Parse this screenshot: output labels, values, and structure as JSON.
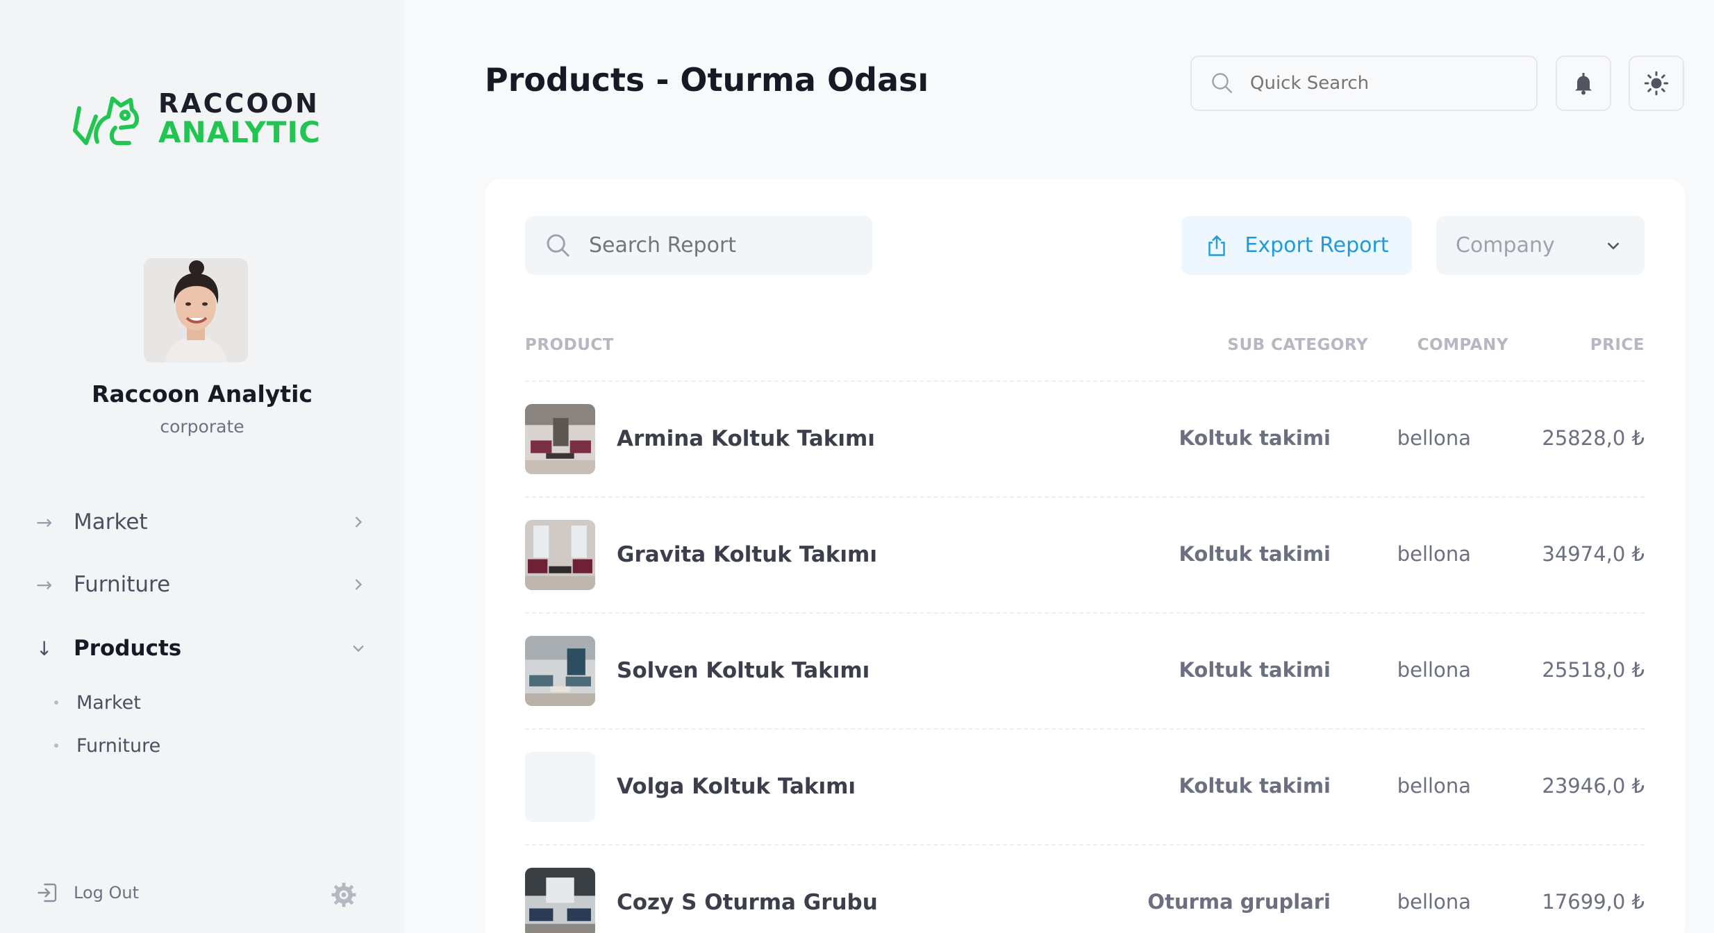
{
  "brand": {
    "line1": "RACCOON",
    "line2": "ANALYTIC",
    "accent": "#23c552"
  },
  "profile": {
    "name": "Raccoon Analytic",
    "role": "corporate"
  },
  "sidebar": {
    "items": [
      {
        "label": "Market",
        "icon": "arrow-right-icon",
        "chevron": "chevron-right-icon"
      },
      {
        "label": "Furniture",
        "icon": "arrow-right-icon",
        "chevron": "chevron-right-icon"
      },
      {
        "label": "Products",
        "icon": "arrow-down-icon",
        "chevron": "chevron-down-icon",
        "active": true
      }
    ],
    "sub_items": [
      {
        "label": "Market"
      },
      {
        "label": "Furniture"
      }
    ],
    "logout_label": "Log Out"
  },
  "header": {
    "title": "Products - Oturma Odası",
    "quick_search_placeholder": "Quick Search"
  },
  "toolbar": {
    "search_placeholder": "Search Report",
    "export_label": "Export Report",
    "company_select": "Company",
    "accent": "#1f9bd8"
  },
  "table": {
    "headers": {
      "product": "PRODUCT",
      "sub_category": "SUB CATEGORY",
      "company": "COMPANY",
      "price": "PRICE"
    },
    "rows": [
      {
        "name": "Armina Koltuk Takımı",
        "sub_category": "Koltuk takimi",
        "company": "bellona",
        "price": "25828,0 ₺",
        "has_image": true
      },
      {
        "name": "Gravita Koltuk Takımı",
        "sub_category": "Koltuk takimi",
        "company": "bellona",
        "price": "34974,0 ₺",
        "has_image": true
      },
      {
        "name": "Solven Koltuk Takımı",
        "sub_category": "Koltuk takimi",
        "company": "bellona",
        "price": "25518,0 ₺",
        "has_image": true
      },
      {
        "name": "Volga Koltuk Takımı",
        "sub_category": "Koltuk takimi",
        "company": "bellona",
        "price": "23946,0 ₺",
        "has_image": false
      },
      {
        "name": "Cozy S Oturma Grubu",
        "sub_category": "Oturma gruplari",
        "company": "bellona",
        "price": "17699,0 ₺",
        "has_image": true
      }
    ]
  }
}
